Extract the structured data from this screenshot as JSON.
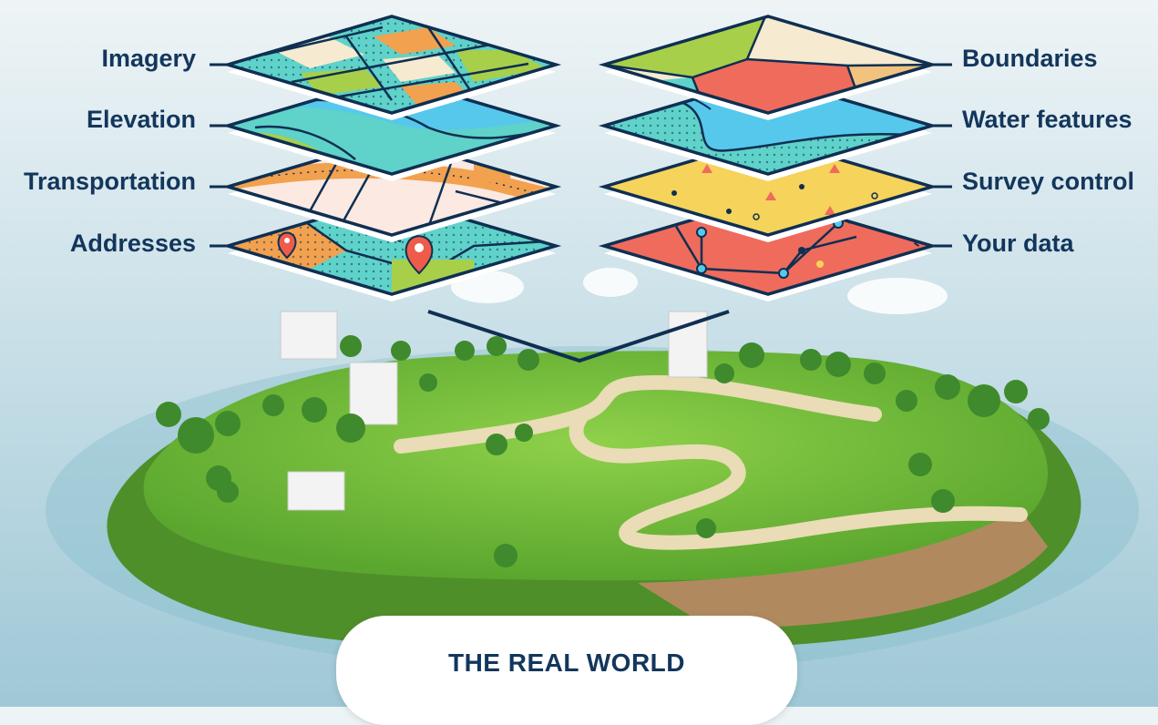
{
  "left_layers": [
    {
      "label": "Imagery"
    },
    {
      "label": "Elevation"
    },
    {
      "label": "Transportation"
    },
    {
      "label": "Addresses"
    }
  ],
  "right_layers": [
    {
      "label": "Boundaries"
    },
    {
      "label": "Water features"
    },
    {
      "label": "Survey control"
    },
    {
      "label": "Your data"
    }
  ],
  "bottom_label": "THE REAL WORLD",
  "colors": {
    "label_text": "#13365c",
    "outline": "#0f2f52",
    "teal": "#5fd2c9",
    "green": "#a8cf4a",
    "orange": "#f2a14f",
    "cream": "#f6ead0",
    "blue": "#56c8ec",
    "yellow": "#f6d35b",
    "coral": "#ef6b5c",
    "grass": "#6fb83b"
  }
}
